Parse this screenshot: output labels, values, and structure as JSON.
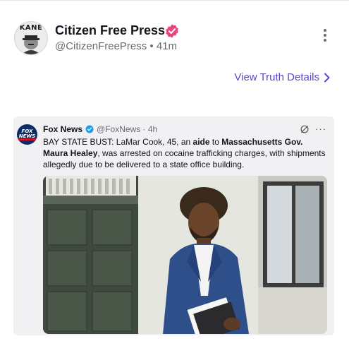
{
  "post": {
    "avatar_text": "KANE",
    "author_name": "Citizen Free Press",
    "author_meta": "@CitizenFreePress • 41m",
    "view_details": "View Truth Details",
    "colors": {
      "accent": "#5a47c9",
      "verified": "#e8467c"
    }
  },
  "embed": {
    "logo_line1": "FOX",
    "logo_line2": "NEWS",
    "name": "Fox News",
    "handle_time": "@FoxNews · 4h",
    "more": "···",
    "text": {
      "p1": "BAY STATE BUST: LaMar Cook, 45, an ",
      "b1": "aide",
      "p2": " to ",
      "b2": "Massachusetts Gov. Maura Healey",
      "p3": ", was arrested on cocaine trafficking charges, with shipments allegedly due to be delivered to a state office building."
    },
    "image": "photo of man in blue suit holding folder outside building"
  }
}
